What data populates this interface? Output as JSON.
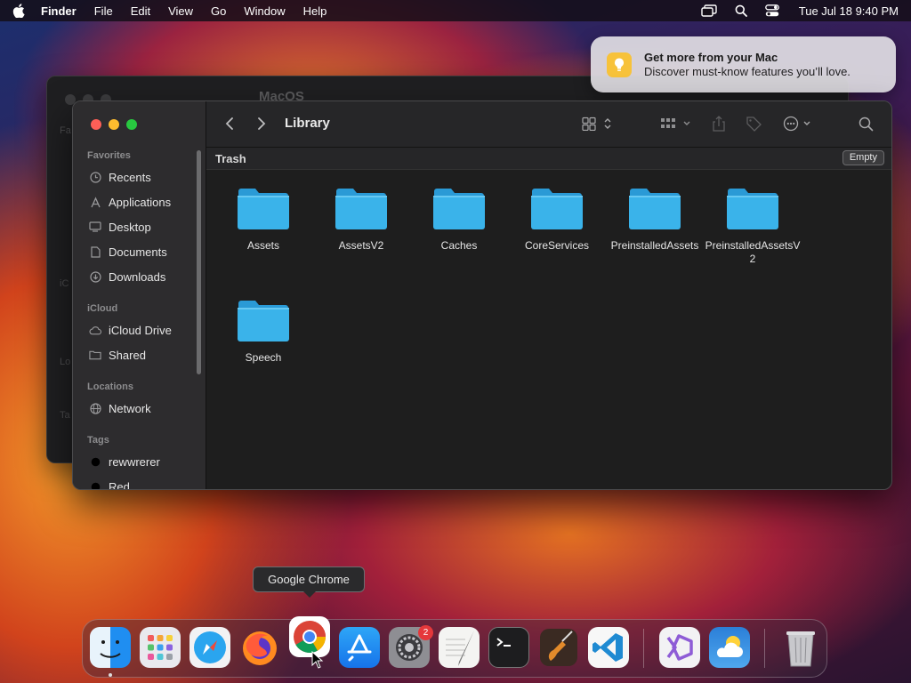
{
  "menubar": {
    "app": "Finder",
    "items": [
      "File",
      "Edit",
      "View",
      "Go",
      "Window",
      "Help"
    ],
    "clock": "Tue Jul 18  9:40 PM"
  },
  "notification": {
    "title": "Get more from your Mac",
    "body": "Discover must-know features you’ll love."
  },
  "background_window": {
    "title": "MacOS",
    "sidebar_fragments": [
      "Fa",
      "iC",
      "Lo",
      "Ta"
    ]
  },
  "finder": {
    "title": "Library",
    "path_label": "Trash",
    "empty_button": "Empty",
    "sidebar": {
      "favorites_heading": "Favorites",
      "favorites": [
        {
          "label": "Recents",
          "icon": "clock-icon"
        },
        {
          "label": "Applications",
          "icon": "applications-icon"
        },
        {
          "label": "Desktop",
          "icon": "desktop-icon"
        },
        {
          "label": "Documents",
          "icon": "document-icon"
        },
        {
          "label": "Downloads",
          "icon": "download-icon"
        }
      ],
      "icloud_heading": "iCloud",
      "icloud": [
        {
          "label": "iCloud Drive",
          "icon": "cloud-icon"
        },
        {
          "label": "Shared",
          "icon": "shared-folder-icon"
        }
      ],
      "locations_heading": "Locations",
      "locations": [
        {
          "label": "Network",
          "icon": "network-icon"
        }
      ],
      "tags_heading": "Tags",
      "tags": [
        {
          "label": "rewwrerer",
          "color": "#000000"
        },
        {
          "label": "Red",
          "color": "#000000"
        }
      ]
    },
    "folders": [
      {
        "name": "Assets"
      },
      {
        "name": "AssetsV2"
      },
      {
        "name": "Caches"
      },
      {
        "name": "CoreServices"
      },
      {
        "name": "PreinstalledAssets"
      },
      {
        "name": "PreinstalledAssetsV2"
      },
      {
        "name": "Speech"
      }
    ]
  },
  "dock": {
    "tooltip": "Google Chrome",
    "apps": [
      "Finder",
      "Launchpad",
      "Safari",
      "Firefox",
      "Google Chrome",
      "App Store",
      "System Settings",
      "TextEdit",
      "Terminal",
      "GarageBand",
      "Visual Studio Code",
      "Visual Studio",
      "Weather",
      "Trash"
    ],
    "system_settings_badge": "2"
  },
  "colors": {
    "folder_blue": "#3ab3ea",
    "close": "#ff5f57",
    "minimize": "#febc2e",
    "zoom": "#28c840"
  }
}
